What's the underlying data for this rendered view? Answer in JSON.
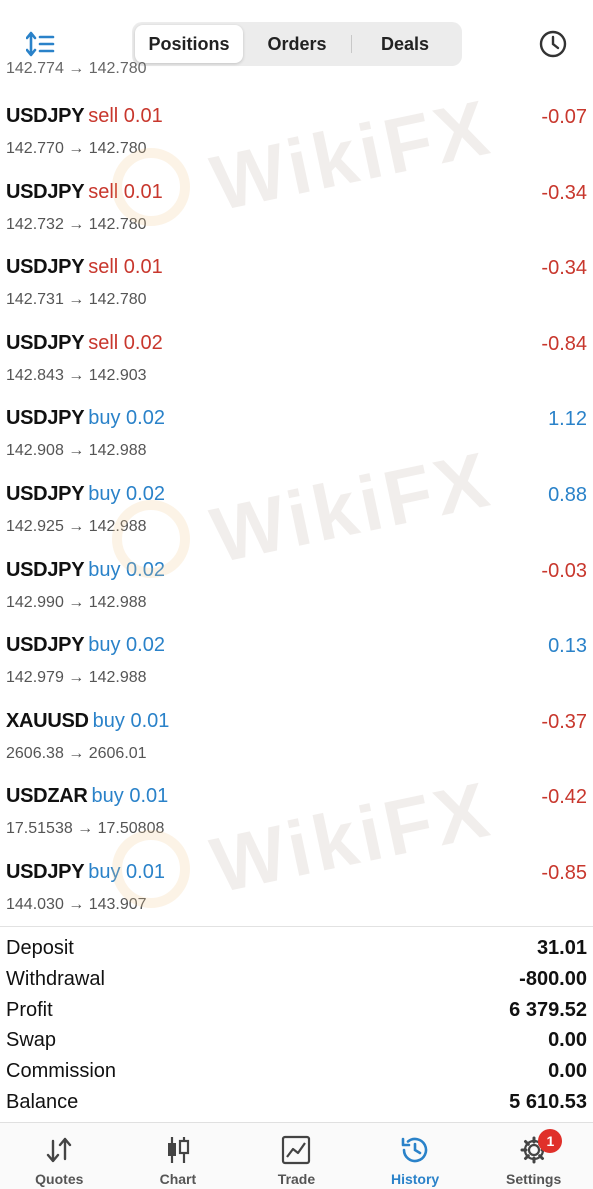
{
  "header": {
    "tabs": [
      {
        "label": "Positions",
        "active": true
      },
      {
        "label": "Orders",
        "active": false
      },
      {
        "label": "Deals",
        "active": false
      }
    ],
    "partial_row_text": "142.774 → 142.780",
    "icons": {
      "left": "sort-icon",
      "right": "clock-icon"
    }
  },
  "deals": [
    {
      "symbol": "USDJPY",
      "side": "sell 0.01",
      "type": "sell",
      "prices": "142.770 → 142.780",
      "profit": "-0.07"
    },
    {
      "symbol": "USDJPY",
      "side": "sell 0.01",
      "type": "sell",
      "prices": "142.732 → 142.780",
      "profit": "-0.34"
    },
    {
      "symbol": "USDJPY",
      "side": "sell 0.01",
      "type": "sell",
      "prices": "142.731 → 142.780",
      "profit": "-0.34"
    },
    {
      "symbol": "USDJPY",
      "side": "sell 0.02",
      "type": "sell",
      "prices": "142.843 → 142.903",
      "profit": "-0.84"
    },
    {
      "symbol": "USDJPY",
      "side": "buy 0.02",
      "type": "buy",
      "prices": "142.908 → 142.988",
      "profit": "1.12"
    },
    {
      "symbol": "USDJPY",
      "side": "buy 0.02",
      "type": "buy",
      "prices": "142.925 → 142.988",
      "profit": "0.88"
    },
    {
      "symbol": "USDJPY",
      "side": "buy 0.02",
      "type": "buy",
      "prices": "142.990 → 142.988",
      "profit": "-0.03"
    },
    {
      "symbol": "USDJPY",
      "side": "buy 0.02",
      "type": "buy",
      "prices": "142.979 → 142.988",
      "profit": "0.13"
    },
    {
      "symbol": "XAUUSD",
      "side": "buy 0.01",
      "type": "buy",
      "prices": "2606.38 → 2606.01",
      "profit": "-0.37"
    },
    {
      "symbol": "USDZAR",
      "side": "buy 0.01",
      "type": "buy",
      "prices": "17.51538 → 17.50808",
      "profit": "-0.42"
    },
    {
      "symbol": "USDJPY",
      "side": "buy 0.01",
      "type": "buy",
      "prices": "144.030 → 143.907",
      "profit": "-0.85"
    }
  ],
  "summary": [
    {
      "label": "Deposit",
      "value": "31.01"
    },
    {
      "label": "Withdrawal",
      "value": "-800.00"
    },
    {
      "label": "Profit",
      "value": "6 379.52"
    },
    {
      "label": "Swap",
      "value": "0.00"
    },
    {
      "label": "Commission",
      "value": "0.00"
    },
    {
      "label": "Balance",
      "value": "5 610.53"
    }
  ],
  "nav": [
    {
      "label": "Quotes",
      "icon": "quotes-arrows-icon",
      "active": false
    },
    {
      "label": "Chart",
      "icon": "candlestick-icon",
      "active": false
    },
    {
      "label": "Trade",
      "icon": "trade-chart-icon",
      "active": false
    },
    {
      "label": "History",
      "icon": "history-clock-icon",
      "active": true
    },
    {
      "label": "Settings",
      "icon": "gear-icon",
      "active": false,
      "badge": "1"
    }
  ],
  "watermark": "WikiFX",
  "colors": {
    "sell": "#c8372d",
    "buy": "#2a82c9",
    "accent": "#2a82c9",
    "badge": "#e0302a"
  }
}
